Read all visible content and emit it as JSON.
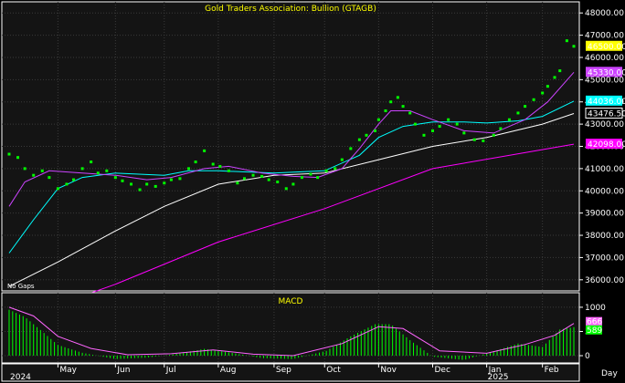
{
  "chart_data": [
    {
      "type": "scatter",
      "title": "Gold  Traders  Association:  Bullion  (GTAGB)",
      "note": "No Gaps",
      "xlabel": "Day",
      "x_start": "2024-04-03",
      "x_end": "2025-02-21",
      "ylim": [
        35500,
        48500
      ],
      "yticks": [
        36000,
        37000,
        38000,
        39000,
        40000,
        41000,
        42000,
        43000,
        44000,
        45000,
        46000,
        47000,
        48000
      ],
      "x_month_labels": [
        "May",
        "Jun",
        "Jul",
        "Aug",
        "Sep",
        "Oct",
        "Nov",
        "Dec",
        "Jan",
        "Feb"
      ],
      "x_month_dates": [
        "2024-05-01",
        "2024-06-03",
        "2024-07-01",
        "2024-08-01",
        "2024-09-02",
        "2024-10-01",
        "2024-11-01",
        "2024-12-02",
        "2025-01-02",
        "2025-02-03"
      ],
      "x_year_labels": [
        {
          "date": "2024-04-03",
          "label": "2024"
        },
        {
          "date": "2025-01-02",
          "label": "2025"
        }
      ],
      "series": [
        {
          "kind": "price",
          "color": "#00ff00",
          "points": [
            [
              "2024-04-03",
              41650
            ],
            [
              "2024-04-08",
              41500
            ],
            [
              "2024-04-12",
              41000
            ],
            [
              "2024-04-17",
              40700
            ],
            [
              "2024-04-22",
              40900
            ],
            [
              "2024-04-26",
              40600
            ],
            [
              "2024-05-01",
              40100
            ],
            [
              "2024-05-06",
              40300
            ],
            [
              "2024-05-10",
              40500
            ],
            [
              "2024-05-15",
              41000
            ],
            [
              "2024-05-20",
              41300
            ],
            [
              "2024-05-24",
              40800
            ],
            [
              "2024-05-29",
              40900
            ],
            [
              "2024-06-03",
              40600
            ],
            [
              "2024-06-07",
              40450
            ],
            [
              "2024-06-12",
              40300
            ],
            [
              "2024-06-17",
              40050
            ],
            [
              "2024-06-21",
              40300
            ],
            [
              "2024-06-26",
              40200
            ],
            [
              "2024-07-01",
              40350
            ],
            [
              "2024-07-05",
              40500
            ],
            [
              "2024-07-10",
              40550
            ],
            [
              "2024-07-15",
              41000
            ],
            [
              "2024-07-19",
              41300
            ],
            [
              "2024-07-24",
              41800
            ],
            [
              "2024-07-29",
              41200
            ],
            [
              "2024-08-02",
              41100
            ],
            [
              "2024-08-07",
              40900
            ],
            [
              "2024-08-12",
              40350
            ],
            [
              "2024-08-16",
              40550
            ],
            [
              "2024-08-21",
              40700
            ],
            [
              "2024-08-26",
              40650
            ],
            [
              "2024-08-30",
              40500
            ],
            [
              "2024-09-04",
              40400
            ],
            [
              "2024-09-09",
              40100
            ],
            [
              "2024-09-13",
              40300
            ],
            [
              "2024-09-18",
              40600
            ],
            [
              "2024-09-23",
              40750
            ],
            [
              "2024-09-27",
              40600
            ],
            [
              "2024-10-02",
              40900
            ],
            [
              "2024-10-07",
              41000
            ],
            [
              "2024-10-11",
              41400
            ],
            [
              "2024-10-16",
              41900
            ],
            [
              "2024-10-21",
              42300
            ],
            [
              "2024-10-25",
              42500
            ],
            [
              "2024-10-30",
              42700
            ],
            [
              "2024-11-01",
              43200
            ],
            [
              "2024-11-05",
              43600
            ],
            [
              "2024-11-08",
              44000
            ],
            [
              "2024-11-12",
              44200
            ],
            [
              "2024-11-15",
              43800
            ],
            [
              "2024-11-19",
              43500
            ],
            [
              "2024-11-22",
              43000
            ],
            [
              "2024-11-27",
              42500
            ],
            [
              "2024-12-02",
              42700
            ],
            [
              "2024-12-06",
              42900
            ],
            [
              "2024-12-11",
              43200
            ],
            [
              "2024-12-16",
              43000
            ],
            [
              "2024-12-20",
              42600
            ],
            [
              "2024-12-26",
              42300
            ],
            [
              "2024-12-31",
              42250
            ],
            [
              "2025-01-06",
              42500
            ],
            [
              "2025-01-10",
              42800
            ],
            [
              "2025-01-15",
              43200
            ],
            [
              "2025-01-20",
              43500
            ],
            [
              "2025-01-24",
              43800
            ],
            [
              "2025-01-29",
              44100
            ],
            [
              "2025-02-03",
              44400
            ],
            [
              "2025-02-06",
              44700
            ],
            [
              "2025-02-10",
              45100
            ],
            [
              "2025-02-13",
              45400
            ],
            [
              "2025-02-17",
              46750
            ],
            [
              "2025-02-21",
              46500
            ]
          ]
        },
        {
          "kind": "line",
          "color": "#ff00ff",
          "last_label": "42098.00",
          "points": [
            [
              "2024-04-03",
              34100
            ],
            [
              "2024-06-03",
              35800
            ],
            [
              "2024-08-01",
              37700
            ],
            [
              "2024-10-01",
              39200
            ],
            [
              "2024-12-02",
              41000
            ],
            [
              "2025-02-21",
              42098
            ]
          ]
        },
        {
          "kind": "line",
          "color": "#ffffff",
          "last_label": "43476.50",
          "points": [
            [
              "2024-04-03",
              35700
            ],
            [
              "2024-05-01",
              36800
            ],
            [
              "2024-06-03",
              38200
            ],
            [
              "2024-07-01",
              39300
            ],
            [
              "2024-08-01",
              40300
            ],
            [
              "2024-09-02",
              40700
            ],
            [
              "2024-10-01",
              40800
            ],
            [
              "2024-11-01",
              41400
            ],
            [
              "2024-12-02",
              42000
            ],
            [
              "2025-01-02",
              42400
            ],
            [
              "2025-02-03",
              43000
            ],
            [
              "2025-02-21",
              43476.5
            ]
          ]
        },
        {
          "kind": "line",
          "color": "#00ffff",
          "last_label": "44036.00",
          "points": [
            [
              "2024-04-03",
              37200
            ],
            [
              "2024-04-17",
              38700
            ],
            [
              "2024-05-01",
              40100
            ],
            [
              "2024-05-15",
              40600
            ],
            [
              "2024-06-03",
              40800
            ],
            [
              "2024-07-01",
              40700
            ],
            [
              "2024-07-15",
              40900
            ],
            [
              "2024-08-01",
              40900
            ],
            [
              "2024-09-02",
              40800
            ],
            [
              "2024-10-01",
              40900
            ],
            [
              "2024-10-21",
              41600
            ],
            [
              "2024-11-01",
              42400
            ],
            [
              "2024-11-15",
              42900
            ],
            [
              "2024-12-02",
              43100
            ],
            [
              "2024-12-20",
              43100
            ],
            [
              "2025-01-02",
              43050
            ],
            [
              "2025-01-20",
              43150
            ],
            [
              "2025-02-03",
              43350
            ],
            [
              "2025-02-21",
              44036
            ]
          ]
        },
        {
          "kind": "line",
          "color": "#cc44ff",
          "last_label": "45330.00",
          "points": [
            [
              "2024-04-03",
              39300
            ],
            [
              "2024-04-12",
              40400
            ],
            [
              "2024-04-26",
              40900
            ],
            [
              "2024-05-15",
              40800
            ],
            [
              "2024-06-03",
              40700
            ],
            [
              "2024-06-21",
              40500
            ],
            [
              "2024-07-05",
              40600
            ],
            [
              "2024-07-24",
              41000
            ],
            [
              "2024-08-07",
              41100
            ],
            [
              "2024-08-26",
              40800
            ],
            [
              "2024-09-13",
              40650
            ],
            [
              "2024-09-27",
              40600
            ],
            [
              "2024-10-11",
              41000
            ],
            [
              "2024-10-21",
              41900
            ],
            [
              "2024-11-01",
              43000
            ],
            [
              "2024-11-08",
              43600
            ],
            [
              "2024-11-19",
              43600
            ],
            [
              "2024-12-02",
              43200
            ],
            [
              "2024-12-20",
              42700
            ],
            [
              "2025-01-06",
              42600
            ],
            [
              "2025-01-24",
              43200
            ],
            [
              "2025-02-06",
              44000
            ],
            [
              "2025-02-21",
              45330
            ]
          ]
        }
      ],
      "price_labels": [
        {
          "text": "46500.00",
          "bg": "#ffff00"
        }
      ]
    },
    {
      "type": "bar",
      "title": "MACD",
      "ylim": [
        -150,
        1300
      ],
      "yticks": [
        0,
        500,
        1000
      ],
      "ytick_labels": [
        "0",
        "500",
        "1000"
      ],
      "value_labels": [
        {
          "text": "666",
          "bg": "#ff66ff",
          "value": 666
        },
        {
          "text": "589",
          "bg": "#00ff00",
          "value": 589
        }
      ],
      "histogram": {
        "color": "#00ff00",
        "points": [
          [
            "2024-04-03",
            950
          ],
          [
            "2024-04-12",
            800
          ],
          [
            "2024-04-22",
            500
          ],
          [
            "2024-05-01",
            220
          ],
          [
            "2024-05-15",
            60
          ],
          [
            "2024-06-03",
            -70
          ],
          [
            "2024-06-21",
            -40
          ],
          [
            "2024-07-05",
            20
          ],
          [
            "2024-07-24",
            140
          ],
          [
            "2024-08-07",
            70
          ],
          [
            "2024-08-26",
            -50
          ],
          [
            "2024-09-13",
            -70
          ],
          [
            "2024-10-02",
            100
          ],
          [
            "2024-10-16",
            400
          ],
          [
            "2024-10-30",
            650
          ],
          [
            "2024-11-08",
            650
          ],
          [
            "2024-11-19",
            320
          ],
          [
            "2024-12-02",
            -20
          ],
          [
            "2024-12-20",
            -90
          ],
          [
            "2025-01-06",
            90
          ],
          [
            "2025-01-20",
            250
          ],
          [
            "2025-02-03",
            180
          ],
          [
            "2025-02-13",
            540
          ],
          [
            "2025-02-21",
            589
          ]
        ]
      },
      "signal": {
        "color": "#ff66ff",
        "points": [
          [
            "2024-04-03",
            1000
          ],
          [
            "2024-04-17",
            820
          ],
          [
            "2024-05-01",
            400
          ],
          [
            "2024-05-20",
            150
          ],
          [
            "2024-06-10",
            20
          ],
          [
            "2024-07-05",
            40
          ],
          [
            "2024-07-29",
            120
          ],
          [
            "2024-08-21",
            30
          ],
          [
            "2024-09-13",
            0
          ],
          [
            "2024-10-11",
            250
          ],
          [
            "2024-11-01",
            600
          ],
          [
            "2024-11-15",
            560
          ],
          [
            "2024-12-06",
            100
          ],
          [
            "2025-01-02",
            50
          ],
          [
            "2025-01-24",
            230
          ],
          [
            "2025-02-10",
            420
          ],
          [
            "2025-02-21",
            666
          ]
        ]
      }
    }
  ]
}
